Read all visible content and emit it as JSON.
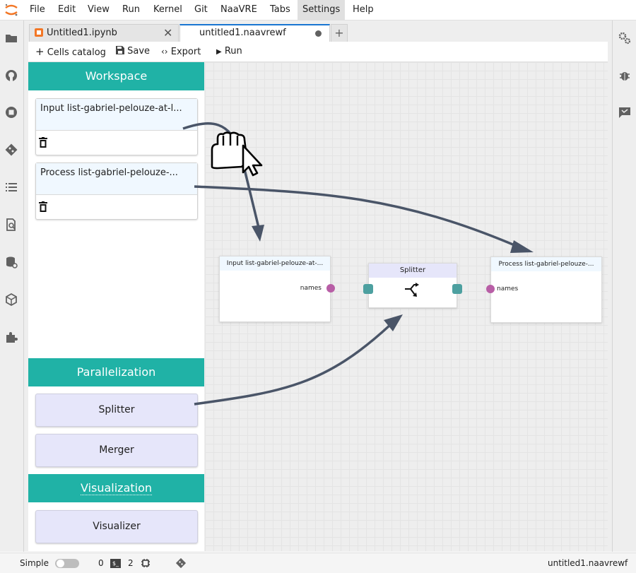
{
  "menu": {
    "items": [
      "File",
      "Edit",
      "View",
      "Run",
      "Kernel",
      "Git",
      "NaaVRE",
      "Tabs",
      "Settings",
      "Help"
    ]
  },
  "tabs": {
    "notebook": {
      "label": "Untitled1.ipynb"
    },
    "workflow": {
      "label": "untitled1.naavrewf"
    },
    "add_label": "+"
  },
  "toolbar": {
    "cells_catalog": "Cells catalog",
    "save": "Save",
    "export": "Export",
    "run": "Run"
  },
  "workspace": {
    "title": "Workspace",
    "cells": [
      {
        "title": "Input list-gabriel-pelouze-at-l..."
      },
      {
        "title": "Process list-gabriel-pelouze-..."
      }
    ]
  },
  "parallelization": {
    "title": "Parallelization",
    "splitter_label": "Splitter",
    "merger_label": "Merger"
  },
  "visualization": {
    "title": "Visualization",
    "visualizer_label": "Visualizer"
  },
  "canvas": {
    "nodes": {
      "input": {
        "title": "Input list-gabriel-pelouze-at-...",
        "port": "names"
      },
      "splitter": {
        "title": "Splitter"
      },
      "process": {
        "title": "Process list-gabriel-pelouze-...",
        "port": "names"
      }
    }
  },
  "statusbar": {
    "mode": "Simple",
    "terminals": "0",
    "kernels": "2",
    "filename": "untitled1.naavrewf"
  },
  "colors": {
    "accent_teal": "#20b2a6",
    "node_header_blue": "#f0f8ff",
    "splitter_header": "#e6e6fa",
    "port_magenta": "#b85ea6",
    "port_teal": "#4da0a0",
    "arrow": "#4a5568"
  },
  "icons": {
    "left_bar": [
      "folder-icon",
      "github-icon",
      "running-icon",
      "git-icon",
      "toc-icon",
      "cell-search-icon",
      "data-icon",
      "package-icon",
      "extension-icon"
    ],
    "right_bar": [
      "property-inspector-icon",
      "debugger-icon",
      "chat-icon"
    ]
  }
}
